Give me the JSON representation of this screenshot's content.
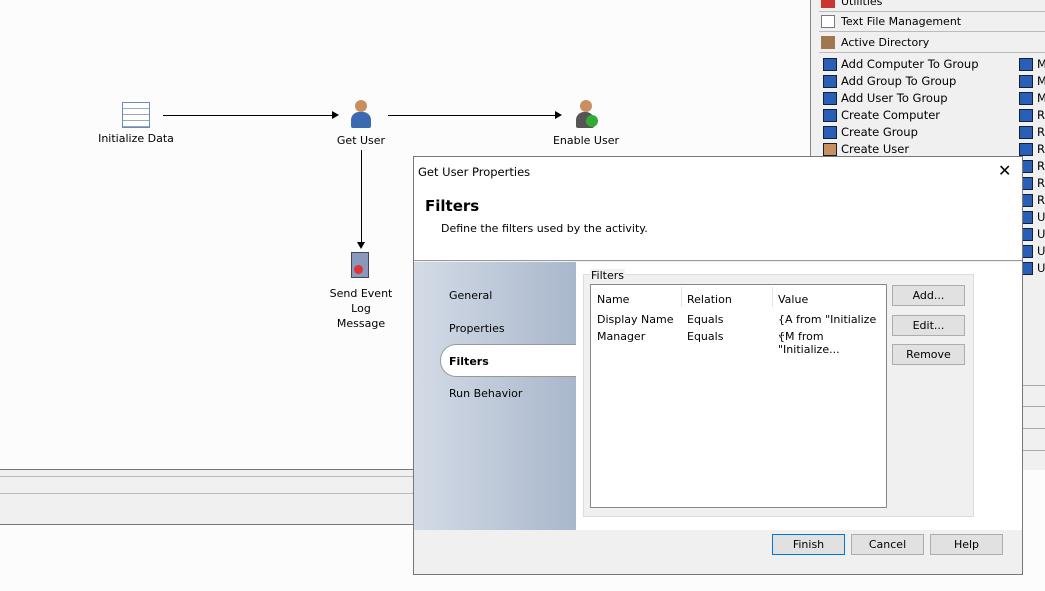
{
  "canvas": {
    "nodes": [
      {
        "label": "Initialize Data"
      },
      {
        "label": "Get User"
      },
      {
        "label": "Enable User"
      },
      {
        "label": "Send Event Log Message"
      }
    ]
  },
  "panel": {
    "categories": [
      "Utilities",
      "Text File Management",
      "Active Directory"
    ],
    "items": [
      "Add Computer To Group",
      "Add Group To Group",
      "Add User To Group",
      "Create Computer",
      "Create Group",
      "Create User"
    ],
    "right_items": [
      "M",
      "M",
      "M",
      "Re",
      "Re",
      "Re",
      "Re",
      "Re",
      "Re",
      "Ur",
      "Up",
      "Up",
      "Up"
    ]
  },
  "dialog": {
    "title": "Get User Properties",
    "heading": "Filters",
    "description": "Define the filters used by the activity.",
    "nav": [
      "General",
      "Properties",
      "Filters",
      "Run Behavior"
    ],
    "active_nav": "Filters",
    "group_label": "Filters",
    "columns": [
      "Name",
      "Relation",
      "Value"
    ],
    "rows": [
      [
        "Display Name",
        "Equals",
        "{A from \"Initialize ..."
      ],
      [
        "Manager",
        "Equals",
        "{M from \"Initialize..."
      ]
    ],
    "buttons": {
      "add": "Add...",
      "edit": "Edit...",
      "remove": "Remove",
      "finish": "Finish",
      "cancel": "Cancel",
      "help": "Help"
    }
  }
}
